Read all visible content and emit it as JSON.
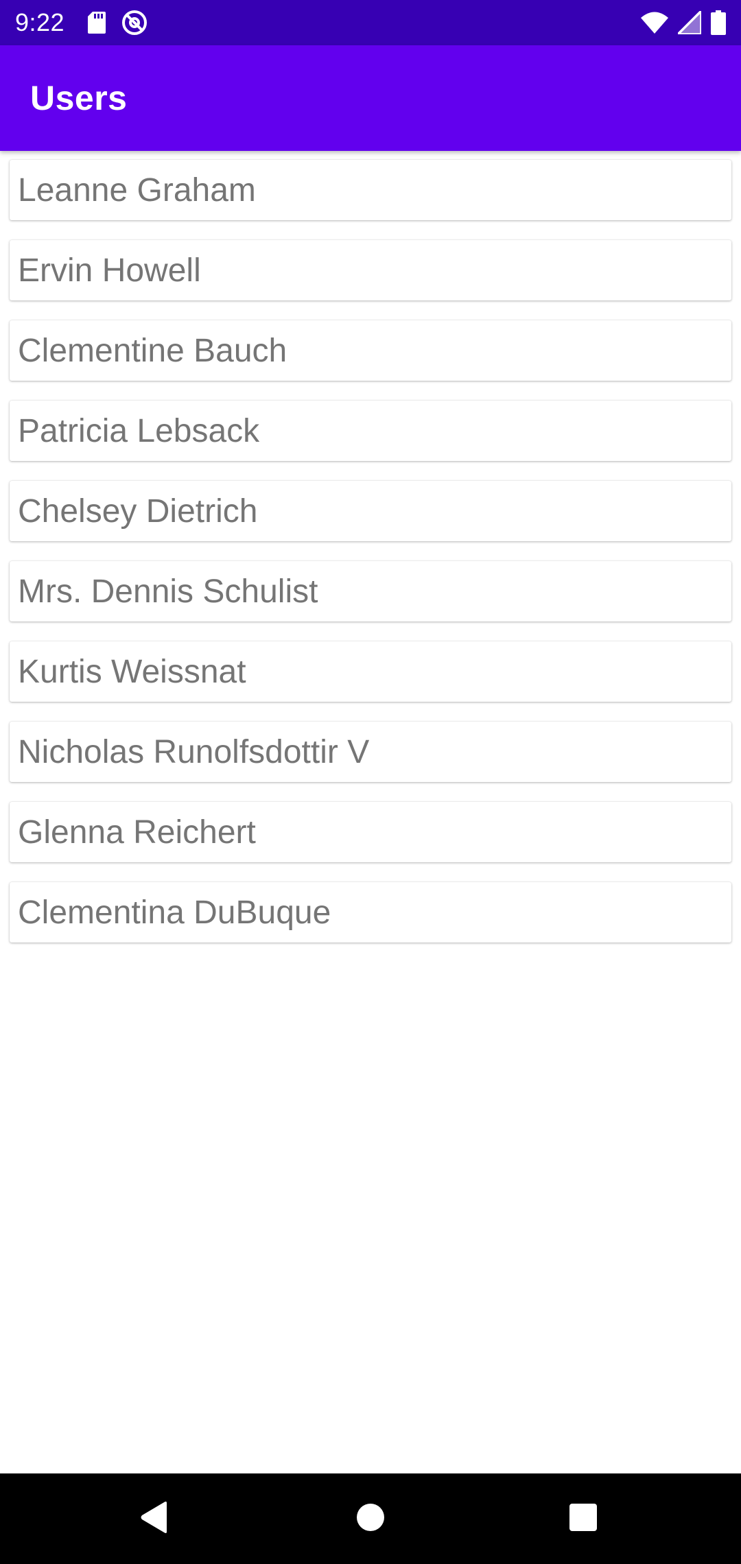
{
  "status_bar": {
    "time": "9:22",
    "icons": [
      "sd-card-icon",
      "do-not-disturb-icon",
      "wifi-icon",
      "signal-icon",
      "battery-icon"
    ]
  },
  "app_bar": {
    "title": "Users"
  },
  "users": [
    {
      "name": "Leanne Graham"
    },
    {
      "name": "Ervin Howell"
    },
    {
      "name": "Clementine Bauch"
    },
    {
      "name": "Patricia Lebsack"
    },
    {
      "name": "Chelsey Dietrich"
    },
    {
      "name": "Mrs. Dennis Schulist"
    },
    {
      "name": "Kurtis Weissnat"
    },
    {
      "name": "Nicholas Runolfsdottir V"
    },
    {
      "name": "Glenna Reichert"
    },
    {
      "name": "Clementina DuBuque"
    }
  ],
  "navigation": {
    "buttons": [
      "back-icon",
      "home-icon",
      "recents-icon"
    ]
  },
  "colors": {
    "status_bar": "#3700b3",
    "app_bar": "#6200ee",
    "list_text": "#757575",
    "nav_bar": "#000000"
  }
}
